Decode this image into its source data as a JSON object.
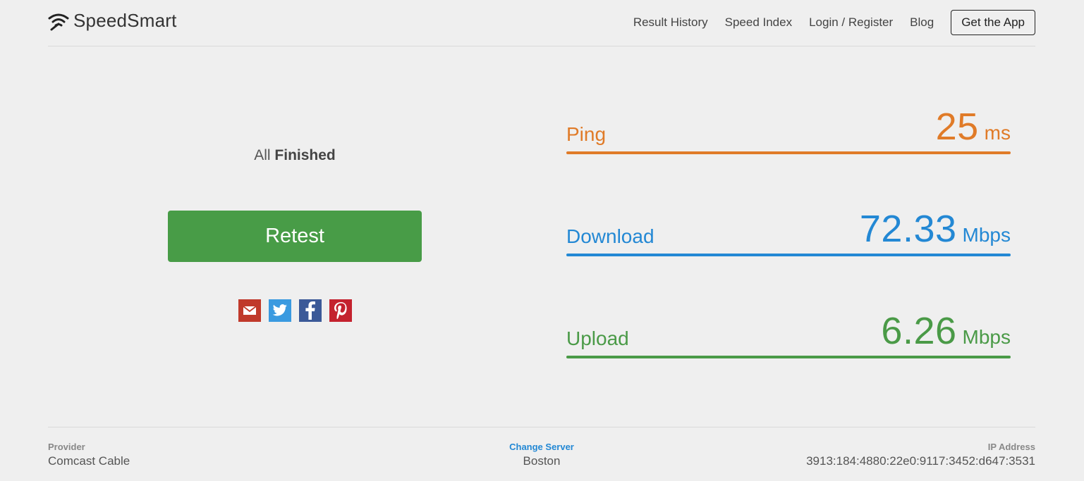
{
  "header": {
    "brand": "SpeedSmart",
    "nav": [
      "Result History",
      "Speed Index",
      "Login / Register",
      "Blog"
    ],
    "get_app": "Get the App"
  },
  "test": {
    "status_prefix": "All",
    "status_bold": "Finished",
    "retest_label": "Retest",
    "share_icons": [
      "email-icon",
      "twitter-icon",
      "facebook-icon",
      "pinterest-icon"
    ]
  },
  "metrics": {
    "ping": {
      "label": "Ping",
      "value": "25",
      "unit": "ms",
      "color": "#e07b28"
    },
    "download": {
      "label": "Download",
      "value": "72.33",
      "unit": "Mbps",
      "color": "#2388d4"
    },
    "upload": {
      "label": "Upload",
      "value": "6.26",
      "unit": "Mbps",
      "color": "#4a9a47"
    }
  },
  "footer": {
    "provider_label": "Provider",
    "provider_value": "Comcast Cable",
    "server_label": "Change Server",
    "server_value": "Boston",
    "ip_label": "IP Address",
    "ip_value": "3913:184:4880:22e0:9117:3452:d647:3531"
  },
  "colors": {
    "retest_button": "#489c47",
    "background": "#efefef"
  }
}
